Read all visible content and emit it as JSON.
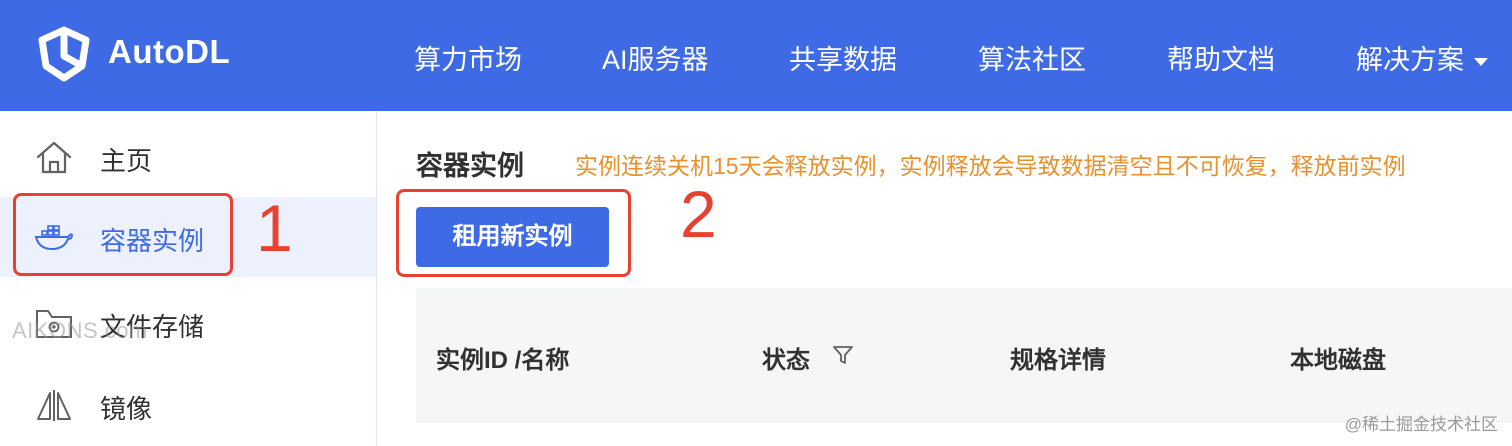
{
  "header": {
    "brand": "AutoDL",
    "nav": [
      {
        "label": "算力市场"
      },
      {
        "label": "AI服务器"
      },
      {
        "label": "共享数据"
      },
      {
        "label": "算法社区"
      },
      {
        "label": "帮助文档"
      },
      {
        "label": "解决方案"
      }
    ]
  },
  "sidebar": {
    "items": [
      {
        "label": "主页",
        "icon": "home-icon"
      },
      {
        "label": "容器实例",
        "icon": "docker-whale-icon",
        "active": true
      },
      {
        "label": "文件存储",
        "icon": "folder-gear-icon"
      },
      {
        "label": "镜像",
        "icon": "mirror-icon"
      }
    ]
  },
  "main": {
    "title": "容器实例",
    "warning": "实例连续关机15天会释放实例，实例释放会导致数据清空且不可恢复，释放前实例",
    "rent_button": "租用新实例",
    "table": {
      "columns": [
        "实例ID /名称",
        "状态",
        "规格详情",
        "本地磁盘"
      ]
    }
  },
  "annotations": {
    "step1": "1",
    "step2": "2"
  },
  "watermark": "AIKONS.com",
  "credit": "@稀土掘金技术社区",
  "colors": {
    "brand_blue": "#3f6ae6",
    "warning_orange": "#e8912d",
    "annotation_red": "#e8412f",
    "active_bg": "#ecf1fd"
  }
}
